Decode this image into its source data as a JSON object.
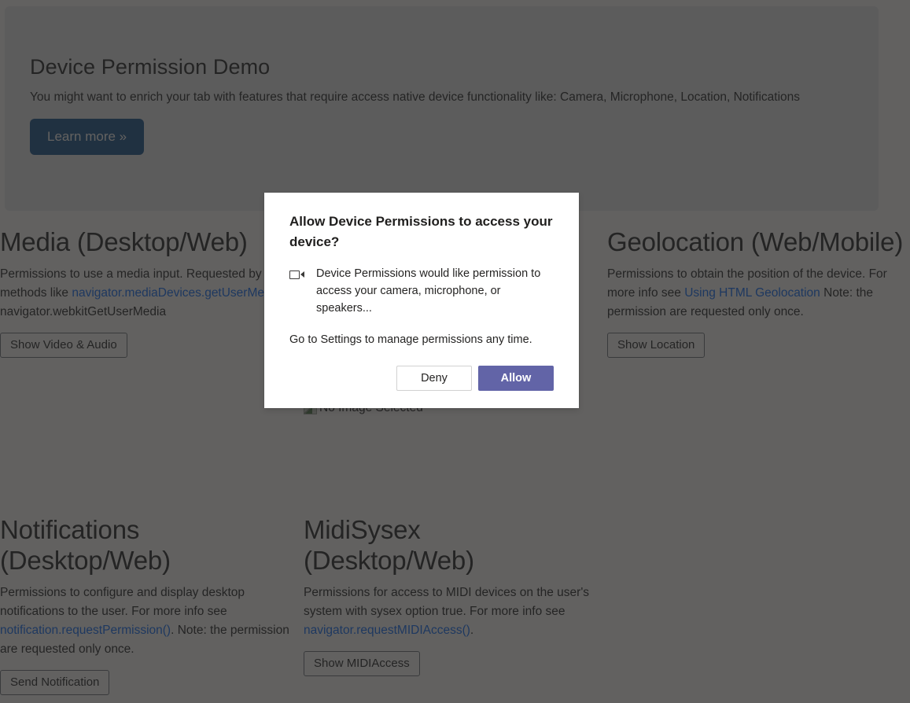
{
  "jumbotron": {
    "title": "Device Permission Demo",
    "description": "You might want to enrich your tab with features that require access native device functionality like: Camera, Microphone, Location, Notifications",
    "learn_more_label": "Learn more »"
  },
  "cards": {
    "media": {
      "title": "Media (Desktop/Web)",
      "text_before_link": "Permissions to use a media input. Requested by methods like ",
      "link_label": "navigator.mediaDevices.getUserMedia",
      "text_after_link": ", navigator.webkitGetUserMedia",
      "button_label": "Show Video & Audio"
    },
    "device_image": {
      "alt_text": "No Image Selected"
    },
    "geolocation": {
      "title": "Geolocation (Web/Mobile)",
      "text_before_link": "Permissions to obtain the position of the device. For more info see ",
      "link_label": "Using HTML Geolocation",
      "text_after_link": " Note: the permission are requested only once.",
      "button_label": "Show Location"
    },
    "notifications": {
      "title": "Notifications (Desktop/Web)",
      "text_before_link": "Permissions to configure and display desktop notifications to the user. For more info see ",
      "link_label": "notification.requestPermission()",
      "text_after_link": ". Note: the permission are requested only once.",
      "button_label": "Send Notification"
    },
    "midisysex": {
      "title": "MidiSysex (Desktop/Web)",
      "text_before_link": "Permissions for access to MIDI devices on the user's system with sysex option true. For more info see ",
      "link_label": "navigator.requestMIDIAccess()",
      "text_after_link": ".",
      "button_label": "Show MIDIAccess"
    }
  },
  "dialog": {
    "title": "Allow Device Permissions to access your device?",
    "description": "Device Permissions would like permission to access your camera, microphone, or speakers...",
    "note": "Go to Settings to manage permissions any time.",
    "deny_label": "Deny",
    "allow_label": "Allow",
    "icon": "camera-icon"
  },
  "colors": {
    "accent": "#6264a7",
    "link": "#0d6efd",
    "jumbotron_button": "#15538f",
    "overlay": "rgba(37,36,35,0.72)"
  }
}
